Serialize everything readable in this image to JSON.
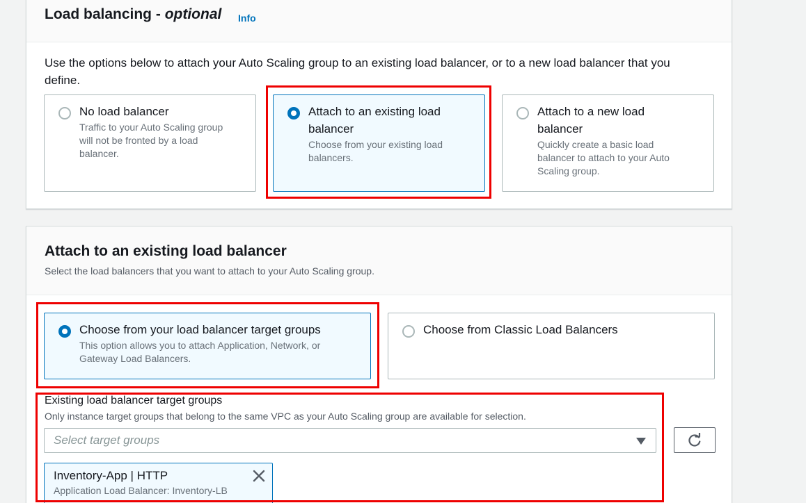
{
  "load_balancing": {
    "title_main": "Load balancing - ",
    "title_optional": "optional",
    "info_link": "Info",
    "description_line1": "Use the options below to attach your Auto Scaling group to an existing load balancer, or to a new load balancer that you",
    "description_line2": "define.",
    "options": [
      {
        "label": "No load balancer",
        "desc_lines": [
          "Traffic to your Auto Scaling group",
          "will not be fronted by a load",
          "balancer."
        ],
        "selected": false
      },
      {
        "label_lines": [
          "Attach to an existing load",
          "balancer"
        ],
        "desc_lines": [
          "Choose from your existing load",
          "balancers."
        ],
        "selected": true
      },
      {
        "label_lines": [
          "Attach to a new load",
          "balancer"
        ],
        "desc_lines": [
          "Quickly create a basic load",
          "balancer to attach to your Auto",
          "Scaling group."
        ],
        "selected": false
      }
    ]
  },
  "attach_existing": {
    "title": "Attach to an existing load balancer",
    "description": "Select the load balancers that you want to attach to your Auto Scaling group.",
    "options": [
      {
        "label": "Choose from your load balancer target groups",
        "desc_lines": [
          "This option allows you to attach Application, Network, or",
          "Gateway Load Balancers."
        ],
        "selected": true
      },
      {
        "label": "Choose from Classic Load Balancers",
        "selected": false
      }
    ],
    "target_groups": {
      "label": "Existing load balancer target groups",
      "description": "Only instance target groups that belong to the same VPC as your Auto Scaling group are available for selection.",
      "placeholder": "Select target groups",
      "selected_token": {
        "title": "Inventory-App | HTTP",
        "subtitle": "Application Load Balancer: Inventory-LB"
      }
    }
  },
  "icons": {
    "caret": "caret-down-icon",
    "refresh": "refresh-icon",
    "remove": "close-icon"
  },
  "colors": {
    "accent": "#0073bb",
    "highlight": "#ee0000",
    "page_background": "#f2f3f3"
  }
}
